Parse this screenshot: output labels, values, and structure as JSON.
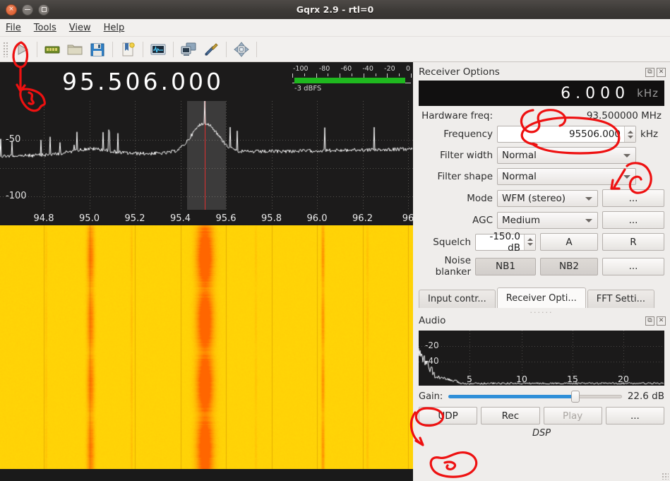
{
  "window": {
    "title": "Gqrx 2.9 - rtl=0",
    "buttons": {
      "close": "×",
      "minimize": "−",
      "maximize": "□"
    }
  },
  "menu": {
    "items": [
      "File",
      "Tools",
      "View",
      "Help"
    ]
  },
  "toolbar": {
    "items": [
      {
        "name": "start-dsp-icon",
        "label": "Start DSP"
      },
      {
        "name": "device-memory-icon",
        "label": "Hardware config"
      },
      {
        "name": "open-folder-icon",
        "label": "Load settings"
      },
      {
        "name": "save-floppy-icon",
        "label": "Save settings"
      },
      {
        "name": "bookmarks-icon",
        "label": "Bookmarks"
      },
      {
        "name": "iq-recorder-icon",
        "label": "I/Q recorder"
      },
      {
        "name": "remote-control-icon",
        "label": "Remote control"
      },
      {
        "name": "tools-settings-icon",
        "label": "Configure"
      },
      {
        "name": "full-screen-icon",
        "label": "Full screen"
      }
    ]
  },
  "receiver_display": {
    "frequency": "95.506.000",
    "meter": {
      "scale_labels": [
        "-100",
        "-80",
        "-60",
        "-40",
        "-20",
        "0"
      ],
      "value_label": "-3 dBFS",
      "fill_percent": 97,
      "fill_color": "#1fb81f"
    }
  },
  "spectrum": {
    "y_labels": [
      "-50",
      "-100"
    ],
    "x_labels": [
      "94.8",
      "95.0",
      "95.2",
      "95.4",
      "95.6",
      "95.8",
      "96.0",
      "96.2",
      "96"
    ],
    "vfo_color": "#e03030",
    "background": "#1c1b1b"
  },
  "waterfall": {
    "base_color": "#ffd400",
    "signal_color": "#ff6a00"
  },
  "receiver_options": {
    "panel_title": "Receiver Options",
    "float_icon": "⧉",
    "close_icon": "✕",
    "lcd_value": "6.000",
    "lcd_unit": "kHz",
    "hardware_freq_label": "Hardware freq:",
    "hardware_freq_value": "93.500000 MHz",
    "frequency_label": "Frequency",
    "frequency_value": "95506.000",
    "frequency_unit": "kHz",
    "filter_width_label": "Filter width",
    "filter_width_value": "Normal",
    "filter_shape_label": "Filter shape",
    "filter_shape_value": "Normal",
    "mode_label": "Mode",
    "mode_value": "WFM (stereo)",
    "mode_more": "...",
    "agc_label": "AGC",
    "agc_value": "Medium",
    "agc_more": "...",
    "squelch_label": "Squelch",
    "squelch_value": "-150.0 dB",
    "squelch_auto": "A",
    "squelch_reset": "R",
    "noise_blanker_label": "Noise blanker",
    "nb1": "NB1",
    "nb2": "NB2",
    "nb_more": "..."
  },
  "tabs": {
    "items": [
      "Input contr...",
      "Receiver Opti...",
      "FFT Setti..."
    ],
    "active_index": 1
  },
  "audio": {
    "panel_title": "Audio",
    "float_icon": "⧉",
    "close_icon": "✕",
    "plot": {
      "y_labels": [
        "-20",
        "-40"
      ],
      "x_labels": [
        "5",
        "10",
        "15",
        "20"
      ]
    },
    "gain_label": "Gain:",
    "gain_value": "22.6 dB",
    "gain_percent": 73,
    "slider_color": "#2f8fd8",
    "buttons": [
      {
        "label": "UDP",
        "disabled": false
      },
      {
        "label": "Rec",
        "disabled": false
      },
      {
        "label": "Play",
        "disabled": true
      },
      {
        "label": "...",
        "disabled": false
      }
    ],
    "footer_label": "DSP"
  },
  "annotations": {
    "color": "#ee1111",
    "marks": [
      "circle-around-start-dsp-button",
      "arrow-to-frequency-display",
      "scribble-near-hardware-freq",
      "circle-around-frequency-spinbox",
      "arrow-to-mode-combo",
      "circle-around-gain-label",
      "arrow-and-scribble-below-udp-button"
    ]
  }
}
